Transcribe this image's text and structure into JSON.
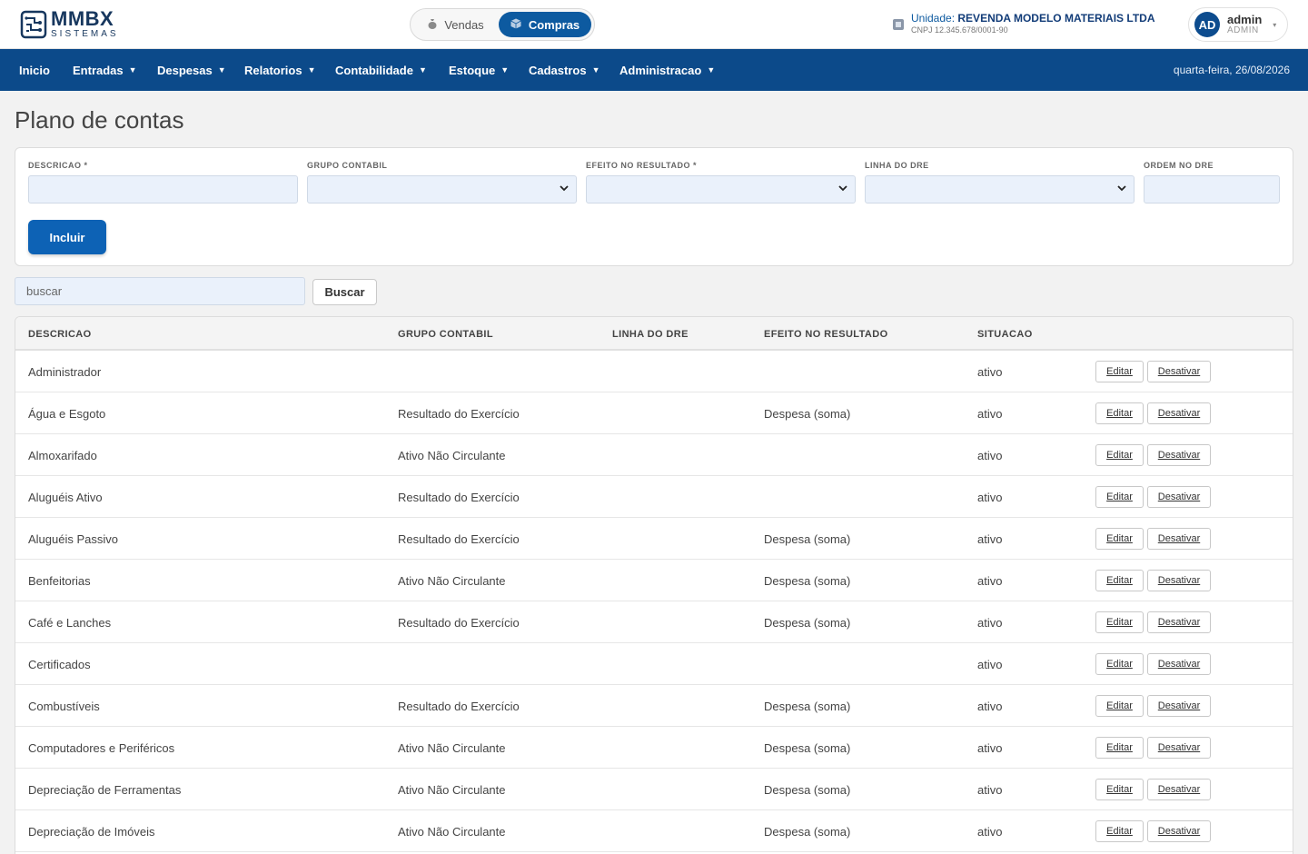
{
  "brand": {
    "name": "MMBX",
    "sub": "SISTEMAS"
  },
  "mode_toggle": {
    "vendas": "Vendas",
    "compras": "Compras",
    "active": "compras"
  },
  "unit": {
    "prefix": "Unidade:",
    "name": "REVENDA MODELO MATERIAIS LTDA",
    "cnpj": "CNPJ 12.345.678/0001-90"
  },
  "user": {
    "initials": "AD",
    "name": "admin",
    "role": "ADMIN"
  },
  "nav": {
    "items": [
      "Inicio",
      "Entradas",
      "Despesas",
      "Relatorios",
      "Contabilidade",
      "Estoque",
      "Cadastros",
      "Administracao"
    ],
    "date": "quarta-feira, 26/08/2026"
  },
  "page": {
    "title": "Plano de contas"
  },
  "form": {
    "descricao_label": "DESCRICAO *",
    "grupo_label": "GRUPO CONTABIL",
    "efeito_label": "EFEITO NO RESULTADO *",
    "linha_label": "LINHA DO DRE",
    "ordem_label": "ORDEM NO DRE",
    "incluir": "Incluir"
  },
  "search": {
    "placeholder": "buscar",
    "button": "Buscar"
  },
  "table": {
    "headers": [
      "DESCRICAO",
      "GRUPO CONTABIL",
      "LINHA DO DRE",
      "EFEITO NO RESULTADO",
      "SITUACAO"
    ],
    "edit_label": "Editar",
    "deactivate_label": "Desativar",
    "rows": [
      {
        "descricao": "Administrador",
        "grupo": "",
        "linha": "",
        "efeito": "",
        "situacao": "ativo"
      },
      {
        "descricao": "Água e Esgoto",
        "grupo": "Resultado do Exercício",
        "linha": "",
        "efeito": "Despesa (soma)",
        "situacao": "ativo"
      },
      {
        "descricao": "Almoxarifado",
        "grupo": "Ativo Não Circulante",
        "linha": "",
        "efeito": "",
        "situacao": "ativo"
      },
      {
        "descricao": "Aluguéis Ativo",
        "grupo": "Resultado do Exercício",
        "linha": "",
        "efeito": "",
        "situacao": "ativo"
      },
      {
        "descricao": "Aluguéis Passivo",
        "grupo": "Resultado do Exercício",
        "linha": "",
        "efeito": "Despesa (soma)",
        "situacao": "ativo"
      },
      {
        "descricao": "Benfeitorias",
        "grupo": "Ativo Não Circulante",
        "linha": "",
        "efeito": "Despesa (soma)",
        "situacao": "ativo"
      },
      {
        "descricao": "Café e Lanches",
        "grupo": "Resultado do Exercício",
        "linha": "",
        "efeito": "Despesa (soma)",
        "situacao": "ativo"
      },
      {
        "descricao": "Certificados",
        "grupo": "",
        "linha": "",
        "efeito": "",
        "situacao": "ativo"
      },
      {
        "descricao": "Combustíveis",
        "grupo": "Resultado do Exercício",
        "linha": "",
        "efeito": "Despesa (soma)",
        "situacao": "ativo"
      },
      {
        "descricao": "Computadores e Periféricos",
        "grupo": "Ativo Não Circulante",
        "linha": "",
        "efeito": "Despesa (soma)",
        "situacao": "ativo"
      },
      {
        "descricao": "Depreciação de Ferramentas",
        "grupo": "Ativo Não Circulante",
        "linha": "",
        "efeito": "Despesa (soma)",
        "situacao": "ativo"
      },
      {
        "descricao": "Depreciação de Imóveis",
        "grupo": "Ativo Não Circulante",
        "linha": "",
        "efeito": "Despesa (soma)",
        "situacao": "ativo"
      }
    ]
  }
}
